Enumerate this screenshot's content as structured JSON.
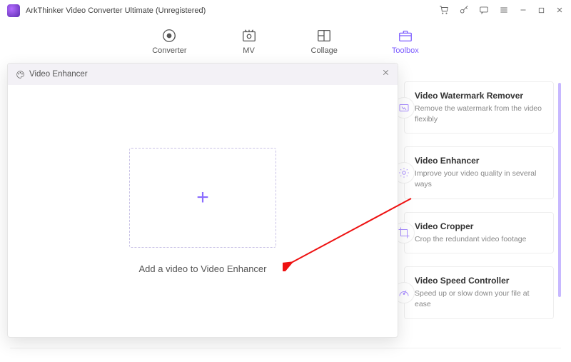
{
  "app": {
    "title": "ArkThinker Video Converter Ultimate (Unregistered)"
  },
  "tabs": {
    "converter": "Converter",
    "mv": "MV",
    "collage": "Collage",
    "toolbox": "Toolbox"
  },
  "modal": {
    "title": "Video Enhancer",
    "dropzone_label": "Add a video to Video Enhancer"
  },
  "cards": {
    "watermark": {
      "title": "Video Watermark Remover",
      "desc": "Remove the watermark from the video flexibly"
    },
    "enhancer": {
      "title": "Video Enhancer",
      "desc": "Improve your video quality in several ways"
    },
    "cropper": {
      "title": "Video Cropper",
      "desc": "Crop the redundant video footage"
    },
    "speed": {
      "title": "Video Speed Controller",
      "desc": "Speed up or slow down your file at ease"
    }
  }
}
